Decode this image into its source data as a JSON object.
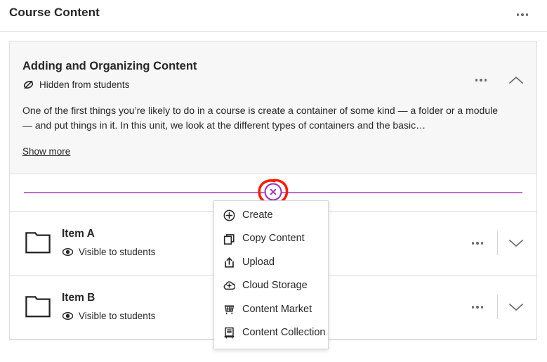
{
  "header": {
    "title": "Course Content",
    "more_icon": "ellipsis-icon"
  },
  "module": {
    "title": "Adding and Organizing Content",
    "visibility_label": "Hidden from students",
    "visibility_icon": "hidden-eye-slash-icon",
    "description": "One of the first things you’re likely to do in a course is create a container of some kind — a folder or a module — and put things in it. In this unit, we look at the different types of containers and the basic…",
    "show_more_label": "Show more",
    "more_icon": "ellipsis-icon",
    "collapse_icon": "chevron-up-icon"
  },
  "add_bar": {
    "button_icon": "close-x-circle-icon",
    "line_color": "#b86fd0",
    "button_color": "#9b30c4",
    "annotation_color": "#fb1d02",
    "annotation_name": "red-highlight-circle"
  },
  "menu": {
    "items": [
      {
        "label": "Create",
        "icon": "plus-circle-icon"
      },
      {
        "label": "Copy Content",
        "icon": "copy-icon"
      },
      {
        "label": "Upload",
        "icon": "upload-icon"
      },
      {
        "label": "Cloud Storage",
        "icon": "cloud-plus-icon"
      },
      {
        "label": "Content Market",
        "icon": "shopping-cart-icon"
      },
      {
        "label": "Content Collection",
        "icon": "content-collection-icon"
      }
    ]
  },
  "items": [
    {
      "name": "Item A",
      "icon": "folder-icon",
      "visibility_label": "Visible to students",
      "visibility_icon": "eye-visible-icon",
      "more_icon": "ellipsis-icon",
      "expand_icon": "chevron-down-icon"
    },
    {
      "name": "Item B",
      "icon": "folder-icon",
      "visibility_label": "Visible to students",
      "visibility_icon": "eye-visible-icon",
      "more_icon": "ellipsis-icon",
      "expand_icon": "chevron-down-icon"
    }
  ]
}
